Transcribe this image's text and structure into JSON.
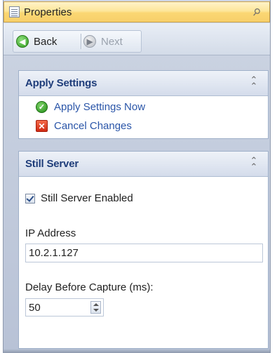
{
  "window": {
    "title": "Properties"
  },
  "toolbar": {
    "back_label": "Back",
    "next_label": "Next"
  },
  "apply_settings": {
    "title": "Apply Settings",
    "tasks": [
      {
        "label": "Apply Settings Now",
        "icon": "check-icon"
      },
      {
        "label": "Cancel Changes",
        "icon": "cancel-icon"
      }
    ]
  },
  "still_server": {
    "title": "Still Server",
    "enabled_label": "Still Server Enabled",
    "enabled_checked": true,
    "ip_label": "IP Address",
    "ip_value": "10.2.1.127",
    "delay_label": "Delay Before Capture (ms):",
    "delay_value": "50"
  },
  "colors": {
    "title_bar": "#fbd773",
    "panel_title": "#1f3d7a",
    "link": "#2a55a8"
  }
}
